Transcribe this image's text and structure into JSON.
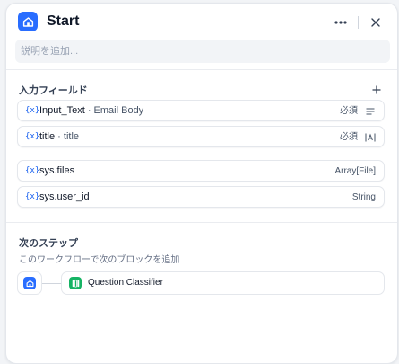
{
  "node": {
    "title": "Start",
    "icon": "home-icon",
    "description_placeholder": "説明を追加..."
  },
  "header_actions": {
    "more_icon": "more-horizontal-icon",
    "close_icon": "close-icon"
  },
  "input_fields": {
    "section_title": "入力フィールド",
    "add_icon": "plus-icon",
    "items": [
      {
        "var_icon": "{x}",
        "name": "Input_Text",
        "separator": " · ",
        "label": "Email Body",
        "required": "必須",
        "type_icon": "paragraph-icon"
      },
      {
        "var_icon": "{x}",
        "name": "title",
        "separator": " · ",
        "label": "title",
        "required": "必須",
        "type_icon": "text-input-icon"
      }
    ]
  },
  "system_vars": [
    {
      "var_icon": "{x}",
      "name": "sys.files",
      "type": "Array[File]"
    },
    {
      "var_icon": "{x}",
      "name": "sys.user_id",
      "type": "String"
    }
  ],
  "next_step": {
    "section_title": "次のステップ",
    "description": "このワークフローで次のブロックを追加",
    "next_node": {
      "label": "Question Classifier",
      "icon": "question-classifier-icon"
    }
  },
  "colors": {
    "accent": "#296dff",
    "classifier": "#16b364",
    "var_icon": "#155eef"
  }
}
